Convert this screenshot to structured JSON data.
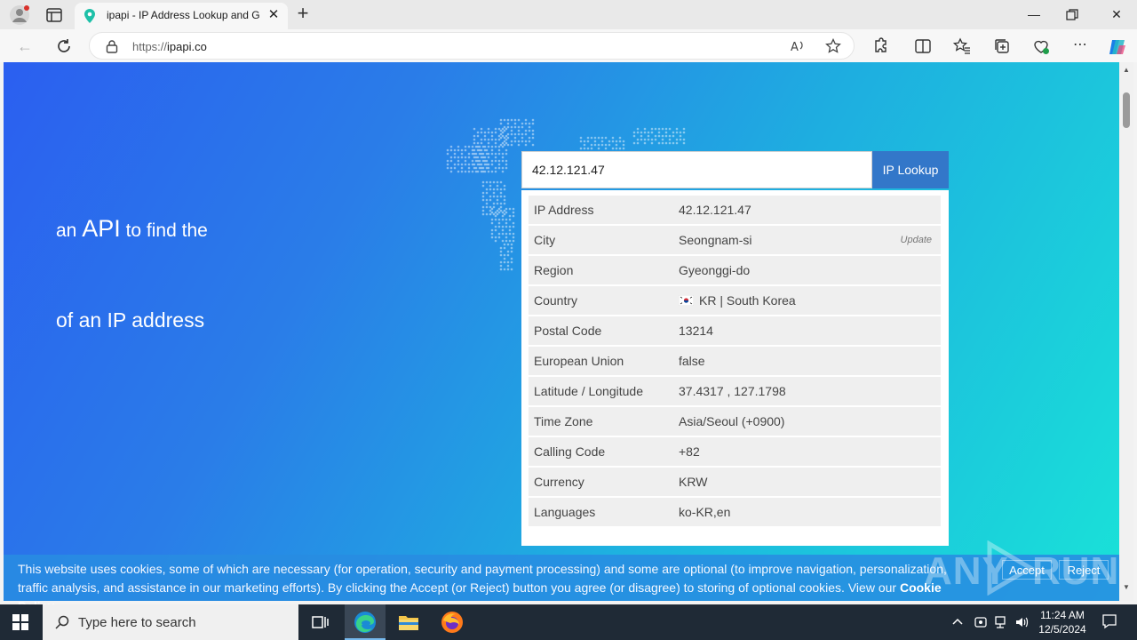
{
  "browser": {
    "tab_title": "ipapi - IP Address Lookup and Ge",
    "url_prefix": "https://",
    "url_domain": "ipapi.co"
  },
  "page": {
    "tagline_part1": "an",
    "tagline_api": "API",
    "tagline_part2": "to find the",
    "tagline_line2": "of an IP address",
    "search": {
      "value": "42.12.121.47",
      "button_label": "IP Lookup"
    },
    "results": [
      {
        "label": "IP Address",
        "value": "42.12.121.47"
      },
      {
        "label": "City",
        "value": "Seongnam-si",
        "action": "Update"
      },
      {
        "label": "Region",
        "value": "Gyeonggi-do"
      },
      {
        "label": "Country",
        "value": "KR | South Korea",
        "flag": "kr-flag-icon"
      },
      {
        "label": "Postal Code",
        "value": "13214"
      },
      {
        "label": "European Union",
        "value": "false"
      },
      {
        "label": "Latitude / Longitude",
        "value": "37.4317 , 127.1798"
      },
      {
        "label": "Time Zone",
        "value": "Asia/Seoul (+0900)"
      },
      {
        "label": "Calling Code",
        "value": "+82"
      },
      {
        "label": "Currency",
        "value": "KRW"
      },
      {
        "label": "Languages",
        "value": "ko-KR,en"
      }
    ]
  },
  "cookie_banner": {
    "text": "This website uses cookies, some of which are necessary (for operation, security and payment processing) and some are optional (to improve navigation, personalization, traffic analysis, and assistance in our marketing efforts). By clicking the Accept (or Reject) button you agree (or disagree) to storing of optional cookies. View our",
    "link": "Cookie Policy",
    "accept": "Accept",
    "reject": "Reject"
  },
  "watermark": "ANY RUN",
  "taskbar": {
    "search_placeholder": "Type here to search",
    "time": "11:24 AM",
    "date": "12/5/2024"
  },
  "colors": {
    "gradient_start": "#2b5ff0",
    "gradient_end": "#19e2d8",
    "lookup_button": "#3377c9"
  }
}
